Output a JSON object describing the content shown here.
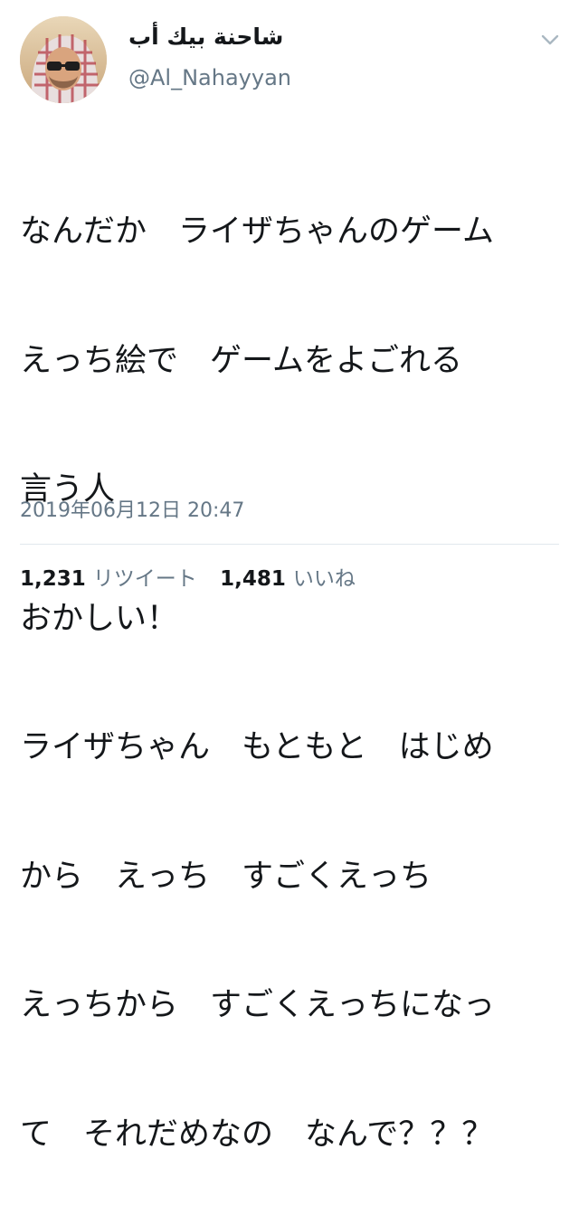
{
  "user": {
    "display_name": "شاحنة بيك أب",
    "handle": "@Al_Nahayyan"
  },
  "tweet": {
    "lines": [
      "なんだか　ライザちゃんのゲーム",
      "えっち絵で　ゲームをよごれる",
      "言う人",
      "おかしい！",
      "ライザちゃん　もともと　はじめ",
      "から　えっち　すごくえっち",
      "えっちから　すごくえっちになっ",
      "て　それだめなの　なんで？？？"
    ],
    "timestamp": "2019年06月12日 20:47"
  },
  "stats": {
    "retweets_count": "1,231",
    "retweets_label": "リツイート",
    "likes_count": "1,481",
    "likes_label": "いいね"
  },
  "icons": {
    "menu": "chevron-down-icon"
  },
  "colors": {
    "text": "#14171a",
    "secondary": "#657786",
    "divider": "#e1e8ed"
  }
}
